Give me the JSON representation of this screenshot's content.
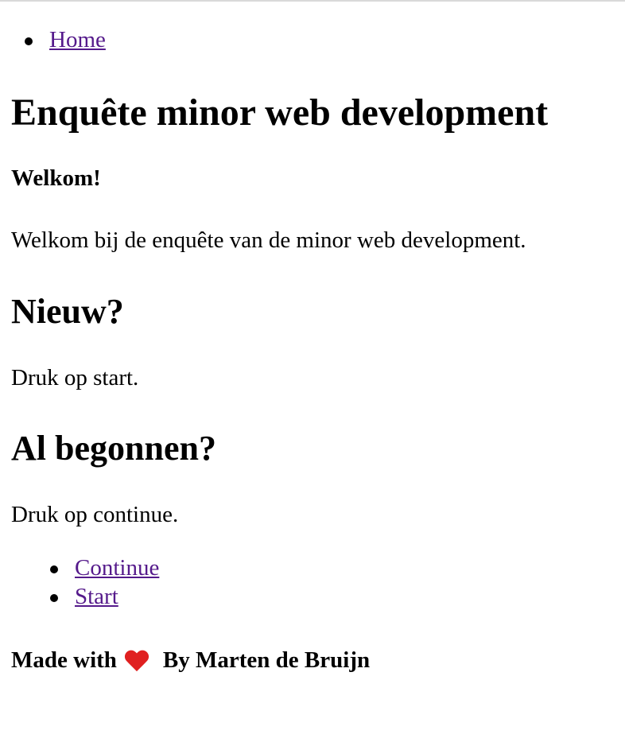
{
  "nav": {
    "items": [
      {
        "label": "Home"
      }
    ]
  },
  "main": {
    "title": "Enquête minor web development",
    "welcome_heading": "Welkom!",
    "welcome_text": "Welkom bij de enquête van de minor web development.",
    "new_heading": "Nieuw?",
    "new_text": "Druk op start.",
    "begun_heading": "Al begonnen?",
    "begun_text": "Druk op continue.",
    "actions": [
      {
        "label": "Continue"
      },
      {
        "label": "Start"
      }
    ]
  },
  "footer": {
    "prefix": "Made with",
    "icon": "heart-icon",
    "suffix": "By Marten de Bruijn"
  },
  "colors": {
    "link": "#551a8b",
    "heart": "#e02020"
  }
}
